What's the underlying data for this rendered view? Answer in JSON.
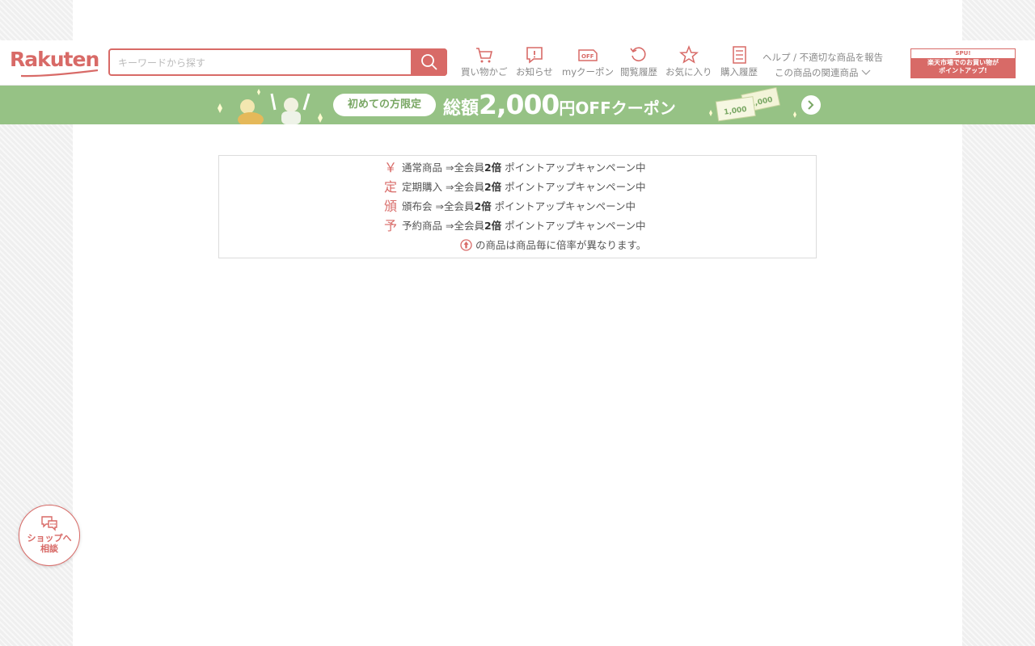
{
  "header": {
    "logo_text": "Rakuten",
    "search_placeholder": "キーワードから探す",
    "nav": [
      {
        "label": "買い物かご",
        "icon": "cart-icon"
      },
      {
        "label": "お知らせ",
        "icon": "notification-icon"
      },
      {
        "label": "myクーポン",
        "icon": "coupon-icon"
      },
      {
        "label": "閲覧履歴",
        "icon": "history-icon"
      },
      {
        "label": "お気に入り",
        "icon": "star-icon"
      },
      {
        "label": "購入履歴",
        "icon": "purchase-list-icon"
      }
    ],
    "help_link": "ヘルプ / 不適切な商品を報告",
    "related_link": "この商品の関連商品",
    "spu": {
      "top": "SPU!",
      "line1": "楽天市場でのお買い物が",
      "line2": "ポイントアップ!"
    }
  },
  "banner": {
    "pill": "初めての方限定",
    "prefix": "総額",
    "amount": "2,000",
    "suffix": "円OFFクーポン",
    "ticket_a": "1,000",
    "ticket_b": "1,000"
  },
  "info": {
    "rows": [
      {
        "icon": "￥",
        "name": "通常商品",
        "arrow": "⇒全会員",
        "rate": "2倍",
        "campaign": "ポイントアップキャンペーン中"
      },
      {
        "icon": "定",
        "name": "定期購入",
        "arrow": "⇒全会員",
        "rate": "2倍",
        "campaign": "ポイントアップキャンペーン中"
      },
      {
        "icon": "頒",
        "name": "頒布会",
        "arrow": "⇒全会員",
        "rate": "2倍",
        "campaign": "ポイントアップキャンペーン中"
      },
      {
        "icon": "予",
        "name": "予約商品",
        "arrow": "⇒全会員",
        "rate": "2倍",
        "campaign": "ポイントアップキャンペーン中"
      }
    ],
    "note": "の商品は商品毎に倍率が異なります。"
  },
  "chat": {
    "line1": "ショップへ",
    "line2": "相談"
  },
  "colors": {
    "accent": "#d86a67",
    "banner": "#96c285"
  }
}
